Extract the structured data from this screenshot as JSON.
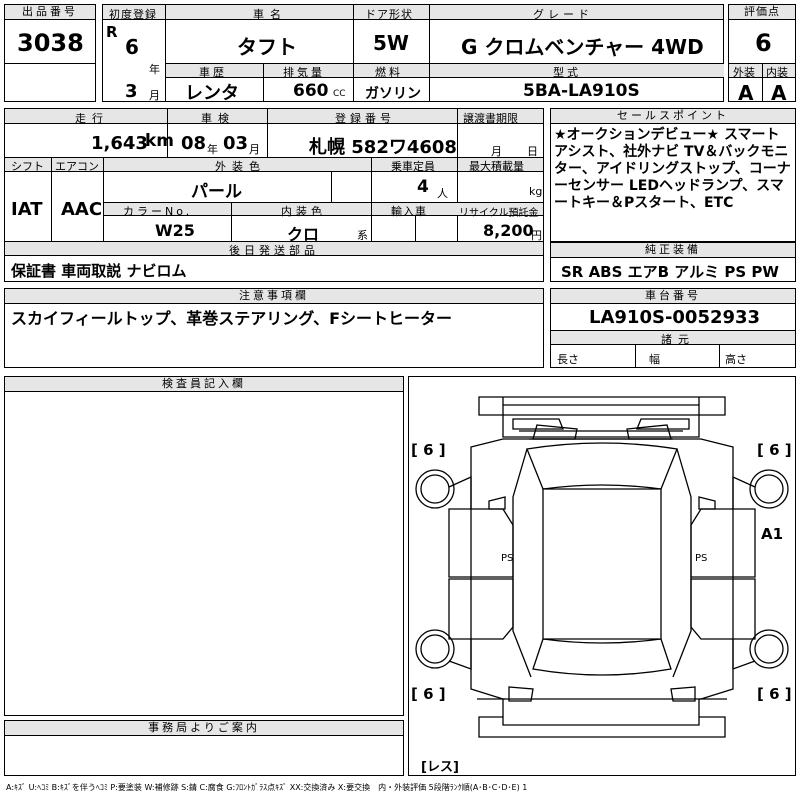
{
  "labels": {
    "lot_no": "出品番号",
    "first_reg": "初度登録",
    "car_name": "車名",
    "door": "ドア形状",
    "grade": "グレード",
    "score": "評価点",
    "history": "車歴",
    "displacement": "排気量",
    "fuel": "燃料",
    "model": "型式",
    "exterior": "外装",
    "interior": "内装",
    "mileage": "走行",
    "inspection": "車検",
    "reg_no": "登録番号",
    "transfer_doc": "譲渡書期限",
    "sales_point": "セールスポイント",
    "shift": "シフト",
    "aircon": "エアコン",
    "ext_color": "外装色",
    "capacity": "乗車定員",
    "max_load": "最大積載量",
    "color_no": "カラーNo.",
    "int_color": "内装色",
    "import": "輸入車",
    "recycle": "リサイクル預託金",
    "later_parts": "後日発送部品",
    "genuine": "純正装備",
    "caution": "注意事項欄",
    "chassis": "車台番号",
    "spec": "諸元",
    "length": "長さ",
    "width": "幅",
    "height": "高さ",
    "inspector": "検査員記入欄",
    "office": "事務局よりご案内"
  },
  "vehicle": {
    "lot_no": "3038",
    "era": "R",
    "reg_year": "6",
    "year_unit": "年",
    "reg_month": "3",
    "month_unit": "月",
    "car_name": "タフト",
    "door": "5W",
    "grade": "G クロムベンチャー 4WD",
    "score": "6",
    "history": "レンタ",
    "displacement": "660",
    "displacement_unit": "CC",
    "fuel": "ガソリン",
    "model": "5BA-LA910S",
    "exterior_score": "A",
    "interior_score": "A",
    "mileage": "1,643",
    "mileage_unit": "km",
    "insp_year": "08",
    "insp_year_unit": "年",
    "insp_month": "03",
    "insp_month_unit": "月",
    "reg_no": "札幌 582ワ4608",
    "transfer_month_unit": "月",
    "transfer_day_unit": "日",
    "shift": "IAT",
    "aircon": "AAC",
    "ext_color": "パール",
    "capacity": "4",
    "capacity_unit": "人",
    "max_load_unit": "kg",
    "color_no": "W25",
    "int_color": "クロ",
    "int_color_unit": "系",
    "recycle": "8,200",
    "recycle_unit": "円",
    "later_parts": "保証書 車両取説 ナビロム",
    "genuine": "SR ABS エアB アルミ PS PW",
    "caution": "スカイフィールトップ、革巻ステアリング、Fシートヒーター",
    "chassis": "LA910S-0052933"
  },
  "sales_points": "★オークションデビュー★ スマートアシスト、社外ナビ TV＆バックモニター、アイドリングストップ、コーナーセンサー LEDヘッドランプ、スマートキー＆Pスタート、ETC",
  "diagram": {
    "tire_fl": "[ 6 ]",
    "tire_fr": "[ 6 ]",
    "tire_rl": "[ 6 ]",
    "tire_rr": "[ 6 ]",
    "mark_a1": "A1",
    "ps_left": "PS",
    "ps_right": "PS",
    "spare": "[レス]"
  },
  "legend": "A:ｷｽﾞ U:ﾍｺﾐ B:ｷｽﾞを伴うﾍｺﾐ P:要塗装 W:補修跡 S:錆 C:腐食 G:ﾌﾛﾝﾄｶﾞﾗｽ点ｷｽﾞ XX:交換済み X:要交換　内・外装評価 5段階ﾗﾝｸ順(A･B･C･D･E) 1"
}
